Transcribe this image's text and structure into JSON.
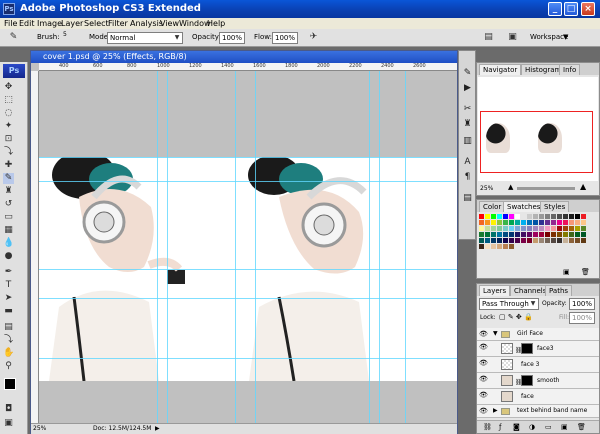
{
  "app": {
    "title": "Adobe Photoshop CS3 Extended"
  },
  "menu": [
    "File",
    "Edit",
    "Image",
    "Layer",
    "Select",
    "Filter",
    "Analysis",
    "View",
    "Window",
    "Help"
  ],
  "options": {
    "brush_label": "Brush:",
    "brush_size": "5",
    "mode_label": "Mode:",
    "mode_value": "Normal",
    "opacity_label": "Opacity:",
    "opacity_value": "100%",
    "flow_label": "Flow:",
    "flow_value": "100%",
    "workspace_label": "Workspace"
  },
  "document": {
    "title": "cover 1.psd @ 25% (Effects, RGB/8)",
    "zoom": "25%",
    "doc_size": "Doc: 12.5M/124.5M",
    "ruler_ticks": [
      "400",
      "600",
      "800",
      "1000",
      "1200",
      "1400",
      "1600",
      "1800",
      "2000",
      "2200",
      "2400",
      "2600"
    ]
  },
  "navigator": {
    "tabs": [
      "Navigator",
      "Histogram",
      "Info"
    ],
    "zoom": "25%"
  },
  "swatches": {
    "tabs": [
      "Color",
      "Swatches",
      "Styles"
    ],
    "colors": [
      "#ff0000",
      "#ffff00",
      "#00ff00",
      "#00ffff",
      "#0000ff",
      "#ff00ff",
      "#ffffff",
      "#e6e6e6",
      "#cccccc",
      "#b3b3b3",
      "#999999",
      "#808080",
      "#666666",
      "#4d4d4d",
      "#333333",
      "#1a1a1a",
      "#000000",
      "#ed1c24",
      "#f26522",
      "#f7941d",
      "#fff200",
      "#8dc63f",
      "#39b54a",
      "#00a651",
      "#00a99d",
      "#00aeef",
      "#0072bc",
      "#0054a6",
      "#2e3192",
      "#662d91",
      "#92278f",
      "#ec008c",
      "#ed145b",
      "#f69679",
      "#f9ad81",
      "#fdc689",
      "#fff79a",
      "#c4df9b",
      "#a3d39c",
      "#82ca9c",
      "#7accc8",
      "#6dcff6",
      "#7da7d9",
      "#8393ca",
      "#8781bd",
      "#a187be",
      "#bd8cbf",
      "#f49ac1",
      "#f5989d",
      "#9e0b0f",
      "#a0410d",
      "#a36209",
      "#aba000",
      "#598527",
      "#197b30",
      "#007236",
      "#00746b",
      "#0076a3",
      "#004a80",
      "#003471",
      "#1b1464",
      "#440e62",
      "#630460",
      "#9e005d",
      "#9e0039",
      "#790000",
      "#7b2e00",
      "#7d4900",
      "#827b00",
      "#406618",
      "#005e20",
      "#005826",
      "#005952",
      "#005b7f",
      "#003663",
      "#002157",
      "#0d004c",
      "#32004b",
      "#4b0049",
      "#7b0046",
      "#7a0026",
      "#c69c6d",
      "#998675",
      "#736357",
      "#534741",
      "#362f2d",
      "#c7b299",
      "#8c6239",
      "#754c24",
      "#603913",
      "#3c2415",
      "#f7ddbd",
      "#e5c4a1",
      "#d4a97e",
      "#b77e51",
      "#8b5a2b"
    ]
  },
  "layers": {
    "tabs": [
      "Layers",
      "Channels",
      "Paths"
    ],
    "blend_mode": "Pass Through",
    "opacity_label": "Opacity:",
    "opacity_value": "100%",
    "lock_label": "Lock:",
    "fill_label": "Fill:",
    "fill_value": "100%",
    "rows": [
      {
        "name": "Girl Face",
        "type": "group"
      },
      {
        "name": "face3",
        "type": "layer-mask"
      },
      {
        "name": "face 3",
        "type": "layer"
      },
      {
        "name": "smooth",
        "type": "layer-mask"
      },
      {
        "name": "face",
        "type": "layer"
      },
      {
        "name": "text behind band name",
        "type": "group"
      }
    ]
  }
}
